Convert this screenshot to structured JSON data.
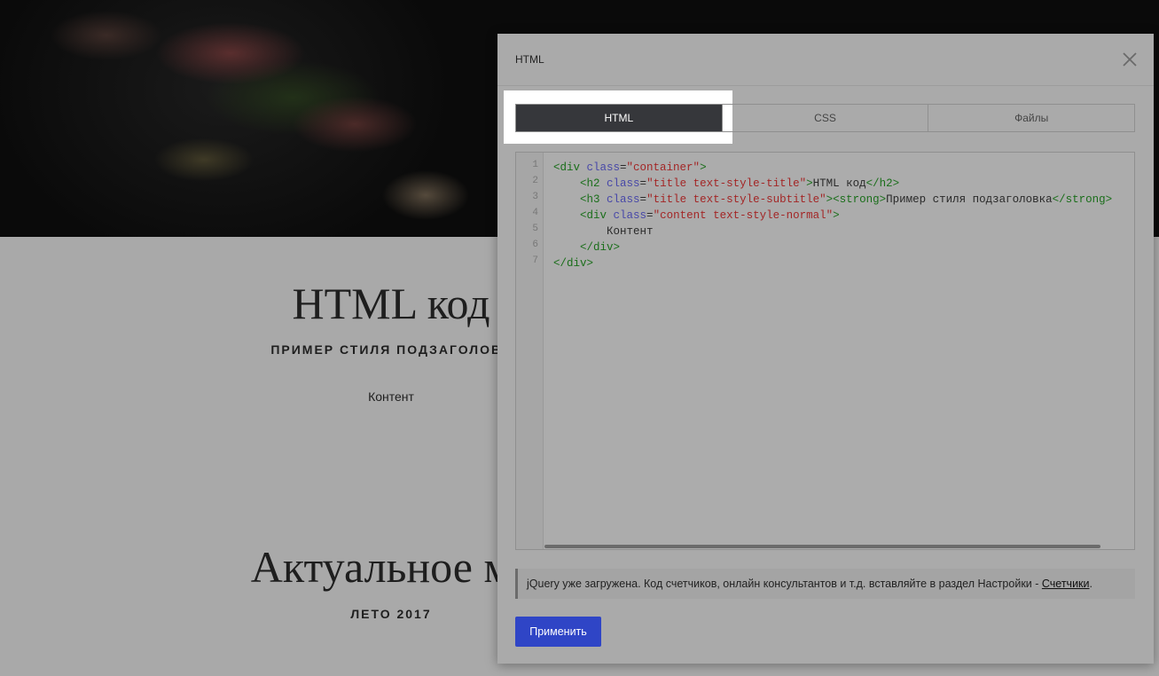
{
  "page": {
    "title1": "HTML код",
    "subtitle1": "ПРИМЕР СТИЛЯ ПОДЗАГОЛОВК",
    "content": "Контент",
    "title2": "Актуальное ме",
    "subtitle2": "ЛЕТО 2017"
  },
  "modal": {
    "title": "HTML",
    "close_icon": "close-icon",
    "tabs": [
      {
        "label": "HTML",
        "active": true
      },
      {
        "label": "CSS",
        "active": false
      },
      {
        "label": "Файлы",
        "active": false
      }
    ],
    "editor": {
      "line_numbers": [
        "1",
        "2",
        "3",
        "4",
        "5",
        "6",
        "7"
      ],
      "lines": [
        [
          {
            "t": "tg",
            "v": "<div "
          },
          {
            "t": "at",
            "v": "class"
          },
          {
            "t": "tx",
            "v": "="
          },
          {
            "t": "st",
            "v": "\"container\""
          },
          {
            "t": "tg",
            "v": ">"
          }
        ],
        [
          {
            "t": "tx",
            "v": "    "
          },
          {
            "t": "tg",
            "v": "<h2 "
          },
          {
            "t": "at",
            "v": "class"
          },
          {
            "t": "tx",
            "v": "="
          },
          {
            "t": "st",
            "v": "\"title text-style-title\""
          },
          {
            "t": "tg",
            "v": ">"
          },
          {
            "t": "tx",
            "v": "HTML код"
          },
          {
            "t": "tg",
            "v": "</h2>"
          }
        ],
        [
          {
            "t": "tx",
            "v": "    "
          },
          {
            "t": "tg",
            "v": "<h3 "
          },
          {
            "t": "at",
            "v": "class"
          },
          {
            "t": "tx",
            "v": "="
          },
          {
            "t": "st",
            "v": "\"title text-style-subtitle\""
          },
          {
            "t": "tg",
            "v": "><strong>"
          },
          {
            "t": "tx",
            "v": "Пример стиля подзаголовка"
          },
          {
            "t": "tg",
            "v": "</strong>"
          }
        ],
        [
          {
            "t": "tx",
            "v": "    "
          },
          {
            "t": "tg",
            "v": "<div "
          },
          {
            "t": "at",
            "v": "class"
          },
          {
            "t": "tx",
            "v": "="
          },
          {
            "t": "st",
            "v": "\"content text-style-normal\""
          },
          {
            "t": "tg",
            "v": ">"
          }
        ],
        [
          {
            "t": "tx",
            "v": "        Контент"
          }
        ],
        [
          {
            "t": "tx",
            "v": "    "
          },
          {
            "t": "tg",
            "v": "</div>"
          }
        ],
        [
          {
            "t": "tg",
            "v": "</div>"
          }
        ]
      ]
    },
    "hint_text": "jQuery уже загружена. Код счетчиков, онлайн консультантов и т.д. вставляйте в раздел Настройки - ",
    "hint_link": "Счетчики",
    "hint_end": ".",
    "apply_label": "Применить",
    "colors": {
      "accent": "#2f45c6",
      "active_tab": "#36373b"
    }
  }
}
